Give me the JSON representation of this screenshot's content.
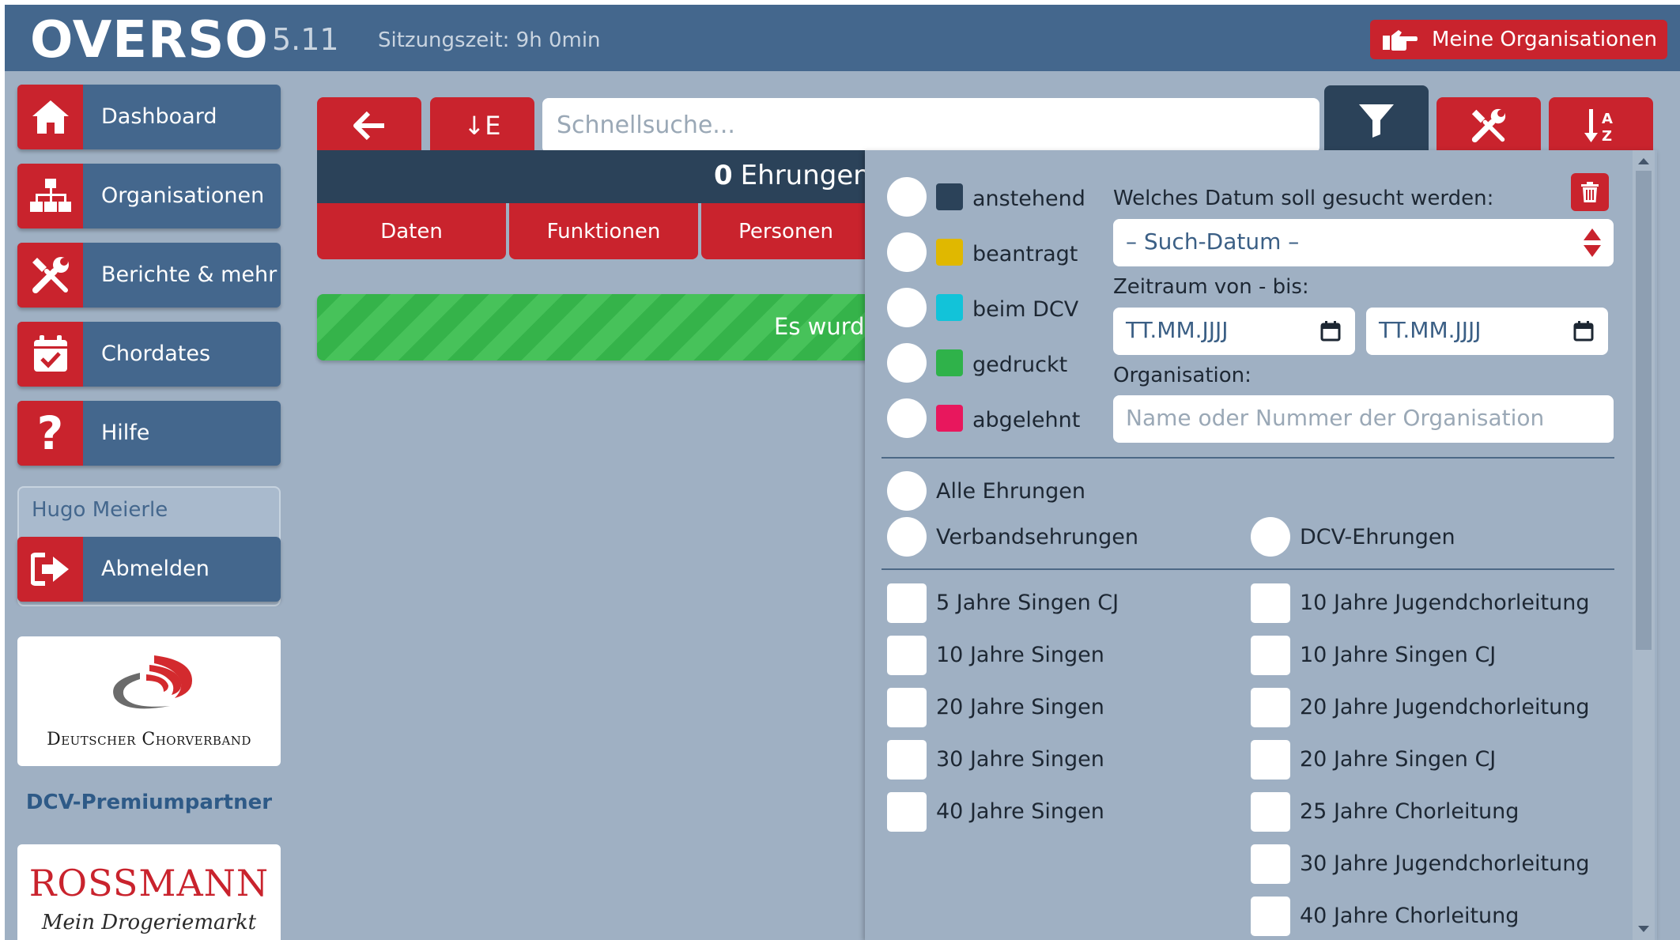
{
  "header": {
    "logo": "OVERSO",
    "version": "5.11",
    "session": "Sitzungszeit: 9h 0min",
    "org_button": "Meine Organisationen"
  },
  "sidebar": {
    "items": [
      {
        "label": "Dashboard",
        "icon": "home-icon"
      },
      {
        "label": "Organisationen",
        "icon": "sitemap-icon"
      },
      {
        "label": "Berichte & mehr",
        "icon": "tools-icon"
      },
      {
        "label": "Chordates",
        "icon": "calendar-check-icon"
      },
      {
        "label": "Hilfe",
        "icon": "question-icon"
      }
    ],
    "user": "Hugo Meierle",
    "logout": "Abmelden",
    "partner_label": "DCV-Premiumpartner",
    "dcv_logo_text": "Deutscher Chorverband",
    "rossmann_text": "ROSSMANN",
    "rossmann_slogan": "Mein Drogeriemarkt"
  },
  "toolbar": {
    "sort_label": "↓E",
    "search_placeholder": "Schnellsuche..."
  },
  "summary": {
    "count": "0",
    "label": "Ehrungen"
  },
  "tabs": [
    "Daten",
    "Funktionen",
    "Personen"
  ],
  "banner": "Es wurd",
  "filter": {
    "statuses": [
      {
        "label": "anstehend",
        "color": "#2b4259"
      },
      {
        "label": "beantragt",
        "color": "#e0b800"
      },
      {
        "label": "beim DCV",
        "color": "#12c3d9"
      },
      {
        "label": "gedruckt",
        "color": "#2fb24a"
      },
      {
        "label": "abgelehnt",
        "color": "#e8175d"
      }
    ],
    "date_question": "Welches Datum soll gesucht werden:",
    "date_select": "– Such-Datum –",
    "range_label": "Zeitraum von - bis:",
    "date_from_placeholder": "TT.MM.JJJJ",
    "date_to_placeholder": "TT.MM.JJJJ",
    "org_label": "Organisation:",
    "org_placeholder": "Name oder Nummer der Organisation",
    "type_all": "Alle Ehrungen",
    "type_verband": "Verbandsehrungen",
    "type_dcv": "DCV-Ehrungen",
    "left_checks": [
      "5 Jahre Singen CJ",
      "10 Jahre Singen",
      "20 Jahre Singen",
      "30 Jahre Singen",
      "40 Jahre Singen"
    ],
    "right_checks": [
      "10 Jahre Jugendchorleitung",
      "10 Jahre Singen CJ",
      "20 Jahre Jugendchorleitung",
      "20 Jahre Singen CJ",
      "25 Jahre Chorleitung",
      "30 Jahre Jugendchorleitung",
      "40 Jahre Chorleitung"
    ]
  },
  "colors": {
    "brand_blue": "#44678d",
    "accent_red": "#c9232d",
    "dark_navy": "#2b4259",
    "background": "#9fb0c3",
    "success_green": "#35b34a"
  }
}
